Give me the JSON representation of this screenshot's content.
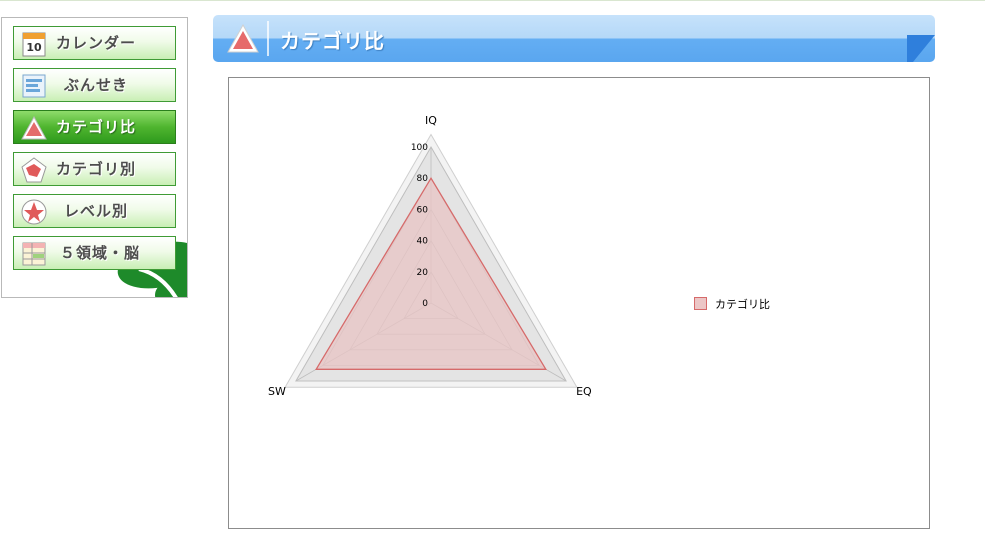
{
  "sidebar": {
    "items": [
      {
        "label": "カレンダー",
        "icon": "calendar-icon",
        "calendar_day": "10",
        "active": false
      },
      {
        "label": "ぶんせき",
        "icon": "analysis-list-icon",
        "active": false
      },
      {
        "label": "カテゴリ比",
        "icon": "triangle-chart-icon",
        "active": true
      },
      {
        "label": "カテゴリ別",
        "icon": "pentagon-chart-icon",
        "active": false
      },
      {
        "label": "レベル別",
        "icon": "star-radar-icon",
        "active": false
      },
      {
        "label": "５領域・脳",
        "icon": "table-grid-icon",
        "active": false
      }
    ]
  },
  "header": {
    "title": "カテゴリ比",
    "icon": "triangle-chart-icon"
  },
  "colors": {
    "accent_blue": "#5ea8f2",
    "nav_green": "#3f9b35",
    "series_line": "#d66a6a",
    "series_fill": "#e8c4c4",
    "background_band": "#e4e4e4"
  },
  "chart_data": {
    "type": "radar",
    "axes": [
      "IQ",
      "EQ",
      "SW"
    ],
    "ticks": [
      0,
      20,
      40,
      60,
      80,
      100
    ],
    "rmin": 0,
    "rmax": 100,
    "series": [
      {
        "name": "カテゴリ比",
        "values": [
          80,
          85,
          85
        ]
      }
    ],
    "legend_position": "right"
  }
}
